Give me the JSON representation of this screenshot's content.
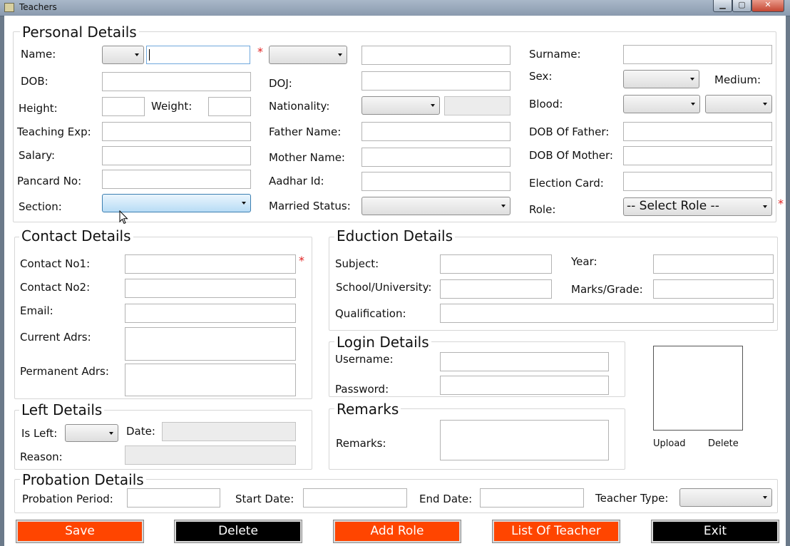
{
  "window": {
    "title": "Teachers",
    "minimize": "▁",
    "maximize": "▢",
    "close": "✕"
  },
  "personal": {
    "title": "Personal Details",
    "name": "Name:",
    "surname": "Surname:",
    "dob": "DOB:",
    "doj": "DOJ:",
    "sex": "Sex:",
    "medium": "Medium:",
    "height": "Height:",
    "weight": "Weight:",
    "nationality": "Nationality:",
    "blood": "Blood:",
    "teaching_exp": "Teaching Exp:",
    "father_name": "Father Name:",
    "dob_father": "DOB Of Father:",
    "salary": "Salary:",
    "mother_name": "Mother Name:",
    "dob_mother": "DOB Of Mother:",
    "pancard": "Pancard No:",
    "aadhar": "Aadhar Id:",
    "election": "Election Card:",
    "section": "Section:",
    "married": "Married Status:",
    "role": "Role:",
    "role_value": "-- Select Role --",
    "required": "*"
  },
  "contact": {
    "title": "Contact Details",
    "no1": "Contact No1:",
    "no2": "Contact No2:",
    "email": "Email:",
    "current": "Current Adrs:",
    "permanent": "Permanent Adrs:",
    "required": "*"
  },
  "education": {
    "title": "Eduction Details",
    "subject": "Subject:",
    "year": "Year:",
    "school": "School/University:",
    "marks": "Marks/Grade:",
    "qualification": "Qualification:"
  },
  "login": {
    "title": "Login Details",
    "username": "Username:",
    "password": "Password:"
  },
  "photo": {
    "upload": "Upload",
    "delete": "Delete"
  },
  "left": {
    "title": "Left Details",
    "is_left": "Is Left:",
    "date": "Date:",
    "reason": "Reason:"
  },
  "remarks": {
    "title": "Remarks",
    "label": "Remarks:"
  },
  "probation": {
    "title": "Probation Details",
    "period": "Probation Period:",
    "start": "Start Date:",
    "end": "End Date:",
    "type": "Teacher Type:"
  },
  "buttons": {
    "save": "Save",
    "delete": "Delete",
    "add_role": "Add Role",
    "list": "List Of Teacher",
    "exit": "Exit"
  },
  "colors": {
    "accent": "#ff4500",
    "dark": "#000000",
    "required": "#e02020"
  }
}
